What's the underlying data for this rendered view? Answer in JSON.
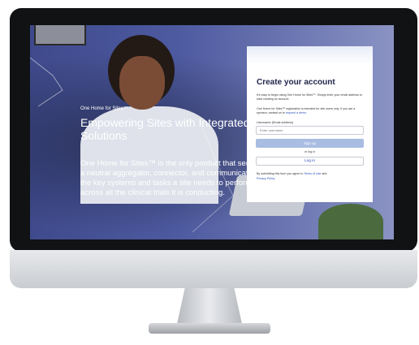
{
  "hero": {
    "brand_small": "One Home for Sites™",
    "title": "Empowering Sites with Integrated Solutions",
    "description": "One Home for Sites™ is the only product that serves as a neutral aggregator, connector, and communicator of the key systems and tasks a site needs to perform across all the clinical trials it is conducting."
  },
  "signup": {
    "title": "Create your account",
    "intro": "It's easy to begin using One Home for Sites™. Simply enter your email address to start creating an account.",
    "note_prefix": "One Home for Sites™ registration is intended for site users only. If you are a sponsor, contact us to",
    "request_demo_link": "request a demo",
    "note_suffix": ".",
    "username_label": "Username (Email address)",
    "username_placeholder": "Enter username",
    "signup_button": "Sign up",
    "or_text": "or log in",
    "login_button": "Log in",
    "terms_prefix": "By submitting this form you agree to",
    "terms_link": "Terms of Use",
    "and_text": "and",
    "privacy_link": "Privacy Policy"
  },
  "colors": {
    "screen_bg": "#4d5aa0",
    "primary_link": "#2d52b8",
    "signup_button_bg": "#a9bce2",
    "title_color": "#20264a"
  }
}
